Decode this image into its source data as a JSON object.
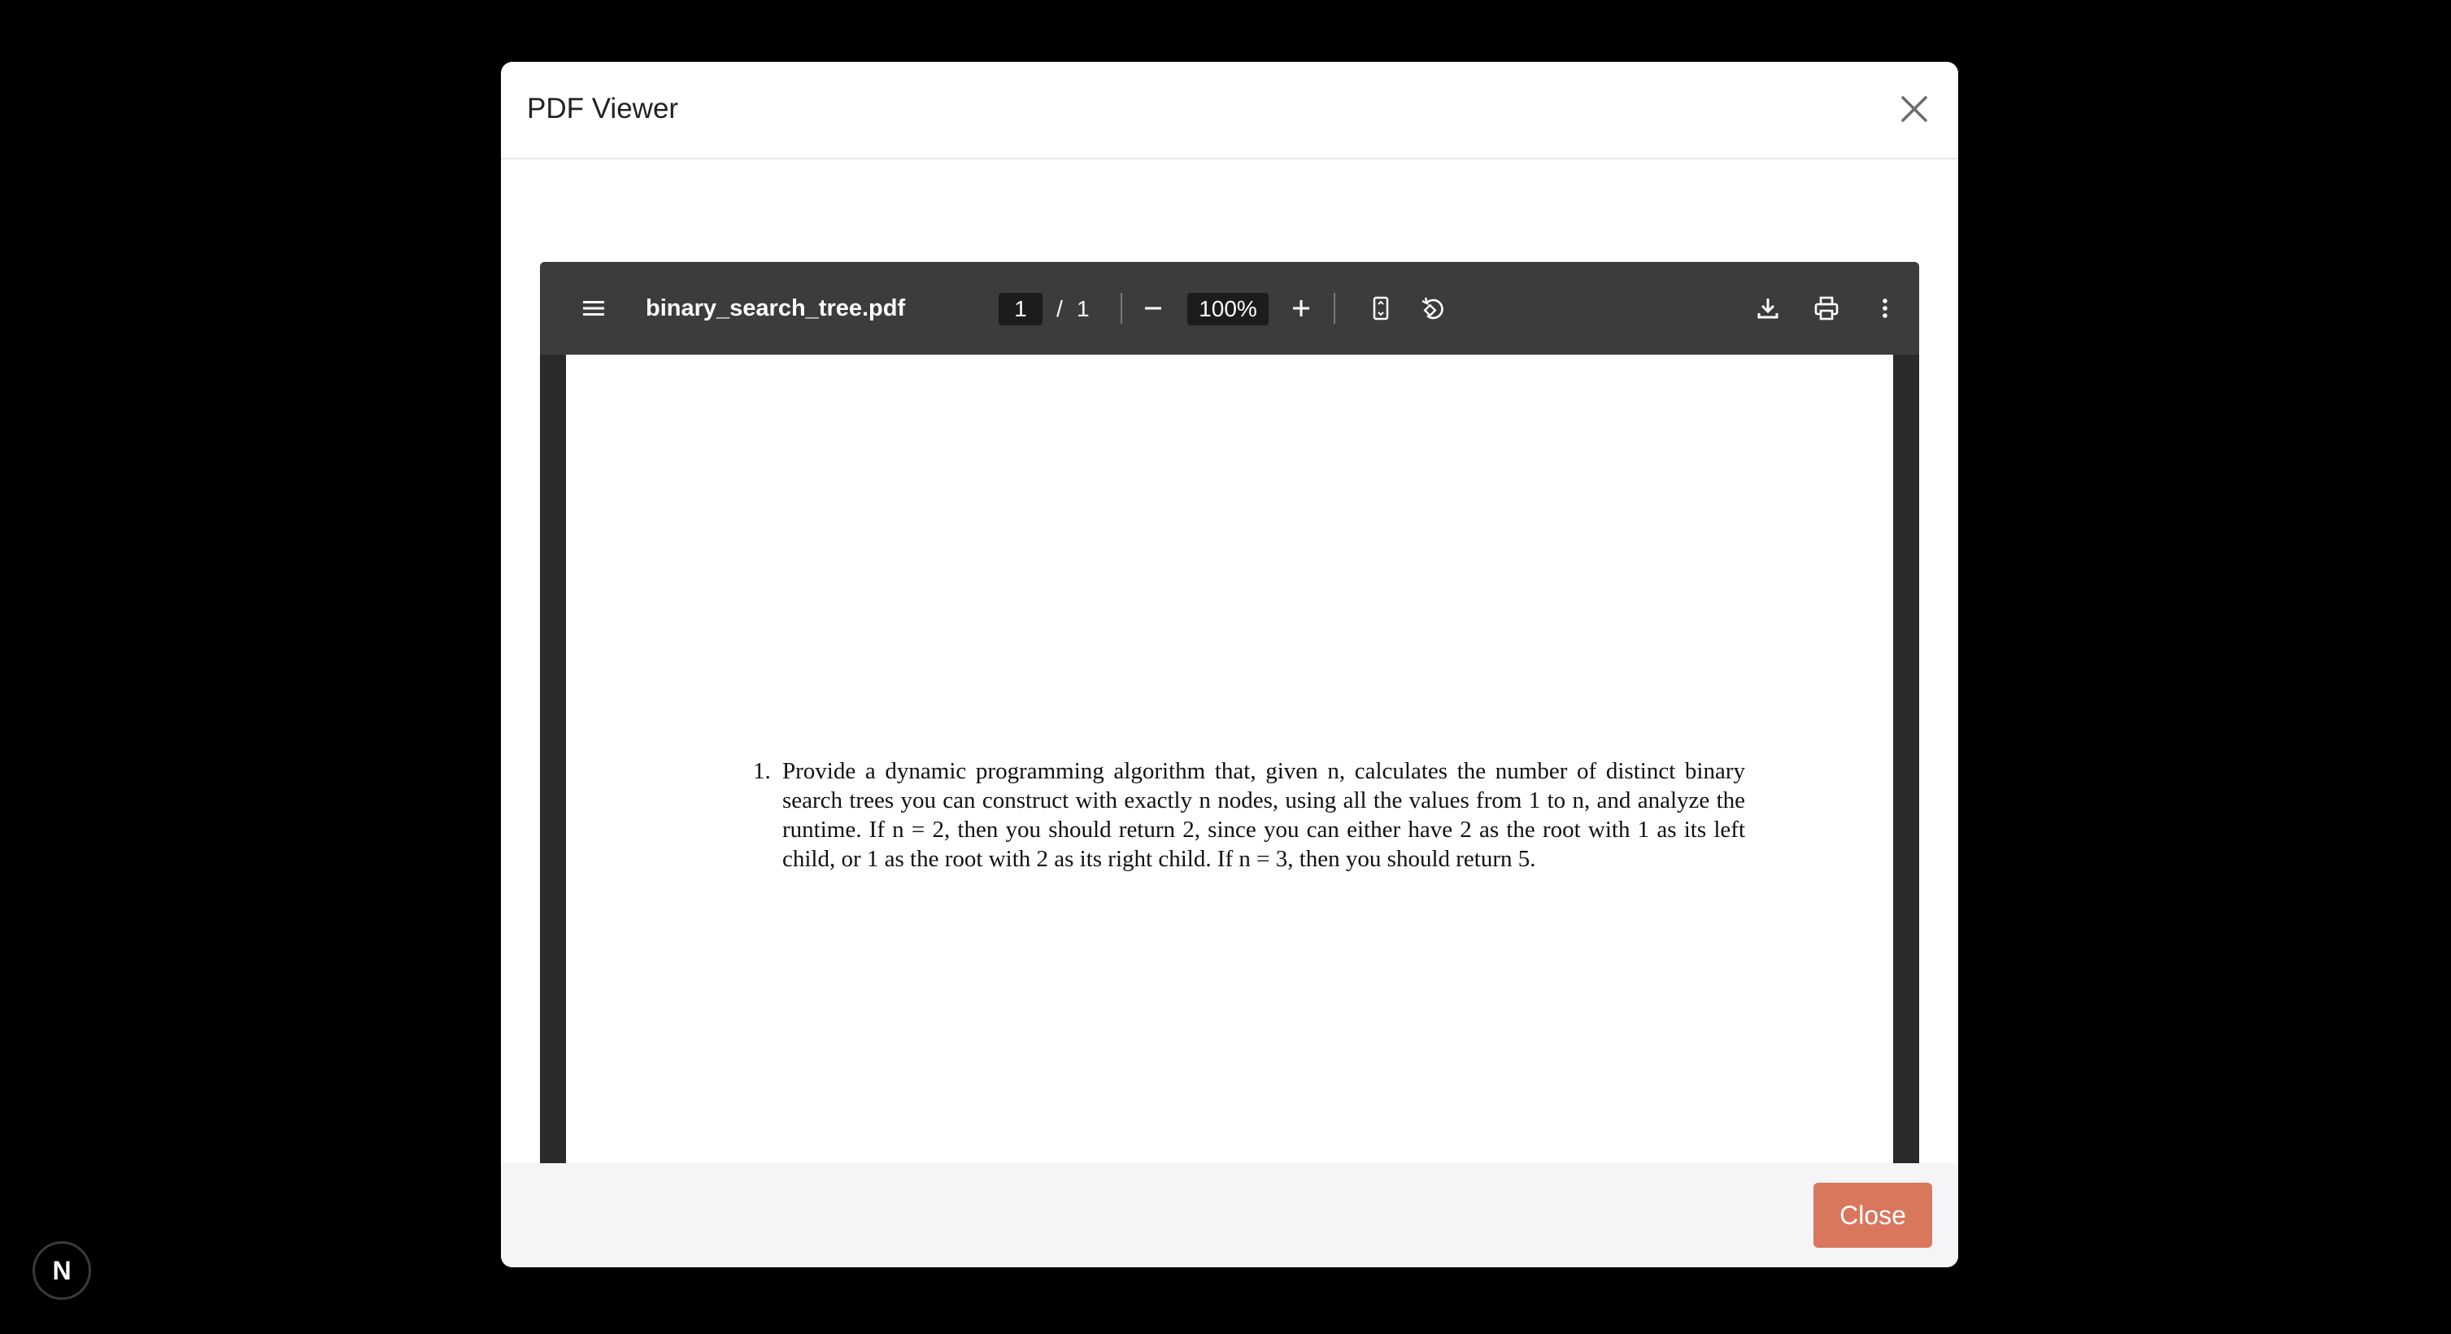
{
  "modal": {
    "title": "PDF Viewer",
    "close_label": "Close"
  },
  "viewer": {
    "filename": "binary_search_tree.pdf",
    "current_page": "1",
    "page_separator": "/",
    "total_pages": "1",
    "zoom": "100%"
  },
  "document": {
    "item_number": "1.",
    "item_text": "Provide a dynamic programming algorithm that, given n, calculates the number of distinct binary search trees you can construct with exactly n nodes, using all the values from 1 to n, and analyze the runtime. If n = 2, then you should return 2, since you can either have 2 as the root with 1 as its left child, or 1 as the root with 2 as its right child. If n = 3, then you should return 5."
  },
  "badge": {
    "letter": "N"
  },
  "icons": {
    "sidebar": "menu-icon",
    "zoom_out": "minus-icon",
    "zoom_in": "plus-icon",
    "fit": "fit-page-icon",
    "rotate": "rotate-icon",
    "download": "download-icon",
    "print": "print-icon",
    "more": "more-vertical-icon",
    "close": "close-icon"
  },
  "colors": {
    "toolbar_bg": "#3c3c3c",
    "viewer_bg": "#2a2a2a",
    "close_button": "#d9775d",
    "backdrop": "#000000"
  }
}
